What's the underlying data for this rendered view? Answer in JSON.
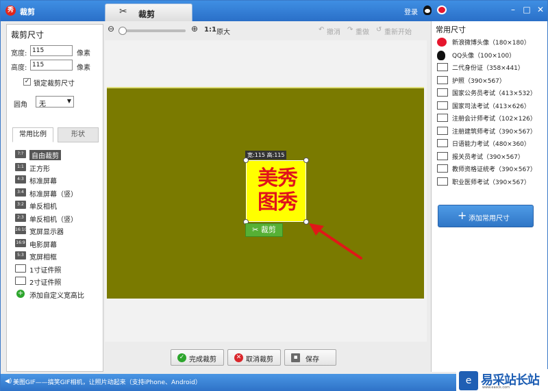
{
  "window": {
    "app_icon_glyph": "秀",
    "title": "裁剪",
    "tab_label": "裁剪",
    "login": "登录",
    "controls": {
      "minimize": "–",
      "maximize": "□",
      "close": "✕"
    }
  },
  "left": {
    "section_title": "裁剪尺寸",
    "width_label": "宽度:",
    "width_value": "115",
    "height_label": "高度:",
    "height_value": "115",
    "unit": "像素",
    "lock_label": "锁定裁剪尺寸",
    "lock_checked": "✓",
    "corner_label": "圆角",
    "corner_value": "无",
    "tabs": [
      "常用比例",
      "形状"
    ],
    "ratios": [
      {
        "icon": "?:?",
        "label": "自由裁剪",
        "selected": true
      },
      {
        "icon": "1:1",
        "label": "正方形"
      },
      {
        "icon": "4:3",
        "label": "标准屏幕"
      },
      {
        "icon": "3:4",
        "label": "标准屏幕（竖）"
      },
      {
        "icon": "3:2",
        "label": "单反相机"
      },
      {
        "icon": "2:3",
        "label": "单反相机（竖）"
      },
      {
        "icon": "16:10",
        "label": "宽屏显示器"
      },
      {
        "icon": "16:9",
        "label": "电影屏幕"
      },
      {
        "icon": "5:3",
        "label": "宽屏相框"
      },
      {
        "icon": "",
        "label": "1寸证件照",
        "card": true
      },
      {
        "icon": "",
        "label": "2寸证件照",
        "card": true
      },
      {
        "icon": "+",
        "label": "添加自定义宽高比",
        "plus": true
      }
    ]
  },
  "toolbar": {
    "zoom_out": "⊖",
    "zoom_in": "⊕",
    "one_to_one": "1:1",
    "original": "原大",
    "undo": "撤消",
    "redo": "重做",
    "restart": "重新开始"
  },
  "canvas": {
    "size_tip": "宽:115 高:115",
    "image_text": "美秀图秀",
    "crop_confirm": "裁剪",
    "canvas_color": "#7a7a00",
    "crop_fill": "#ffff00"
  },
  "bottom": {
    "done": "完成裁剪",
    "cancel": "取消裁剪",
    "save": "保存"
  },
  "right": {
    "title": "常用尺寸",
    "presets": [
      {
        "icon": "weibo",
        "label": "新浪微博头像（180×180）"
      },
      {
        "icon": "qq",
        "label": "QQ头像（100×100）"
      },
      {
        "icon": "card",
        "label": "二代身份证（358×441）"
      },
      {
        "icon": "card",
        "label": "护照（390×567）"
      },
      {
        "icon": "card",
        "label": "国家公务员考试（413×532）"
      },
      {
        "icon": "card",
        "label": "国家司法考试（413×626）"
      },
      {
        "icon": "card",
        "label": "注册会计师考试（102×126）"
      },
      {
        "icon": "card",
        "label": "注册建筑师考试（390×567）"
      },
      {
        "icon": "card",
        "label": "日语能力考试（480×360）"
      },
      {
        "icon": "card",
        "label": "报关员考试（390×567）"
      },
      {
        "icon": "card",
        "label": "教师资格证统考（390×567）"
      },
      {
        "icon": "card",
        "label": "职业医师考试（390×567）"
      }
    ],
    "add_button": "添加常用尺寸"
  },
  "status": {
    "text": "美图GIF——搞笑GIF相机，让照片动起来（支持iPhone、Android）"
  },
  "watermark": {
    "logo": "e",
    "text": "易采站长站",
    "sub": "www.easck.com"
  }
}
